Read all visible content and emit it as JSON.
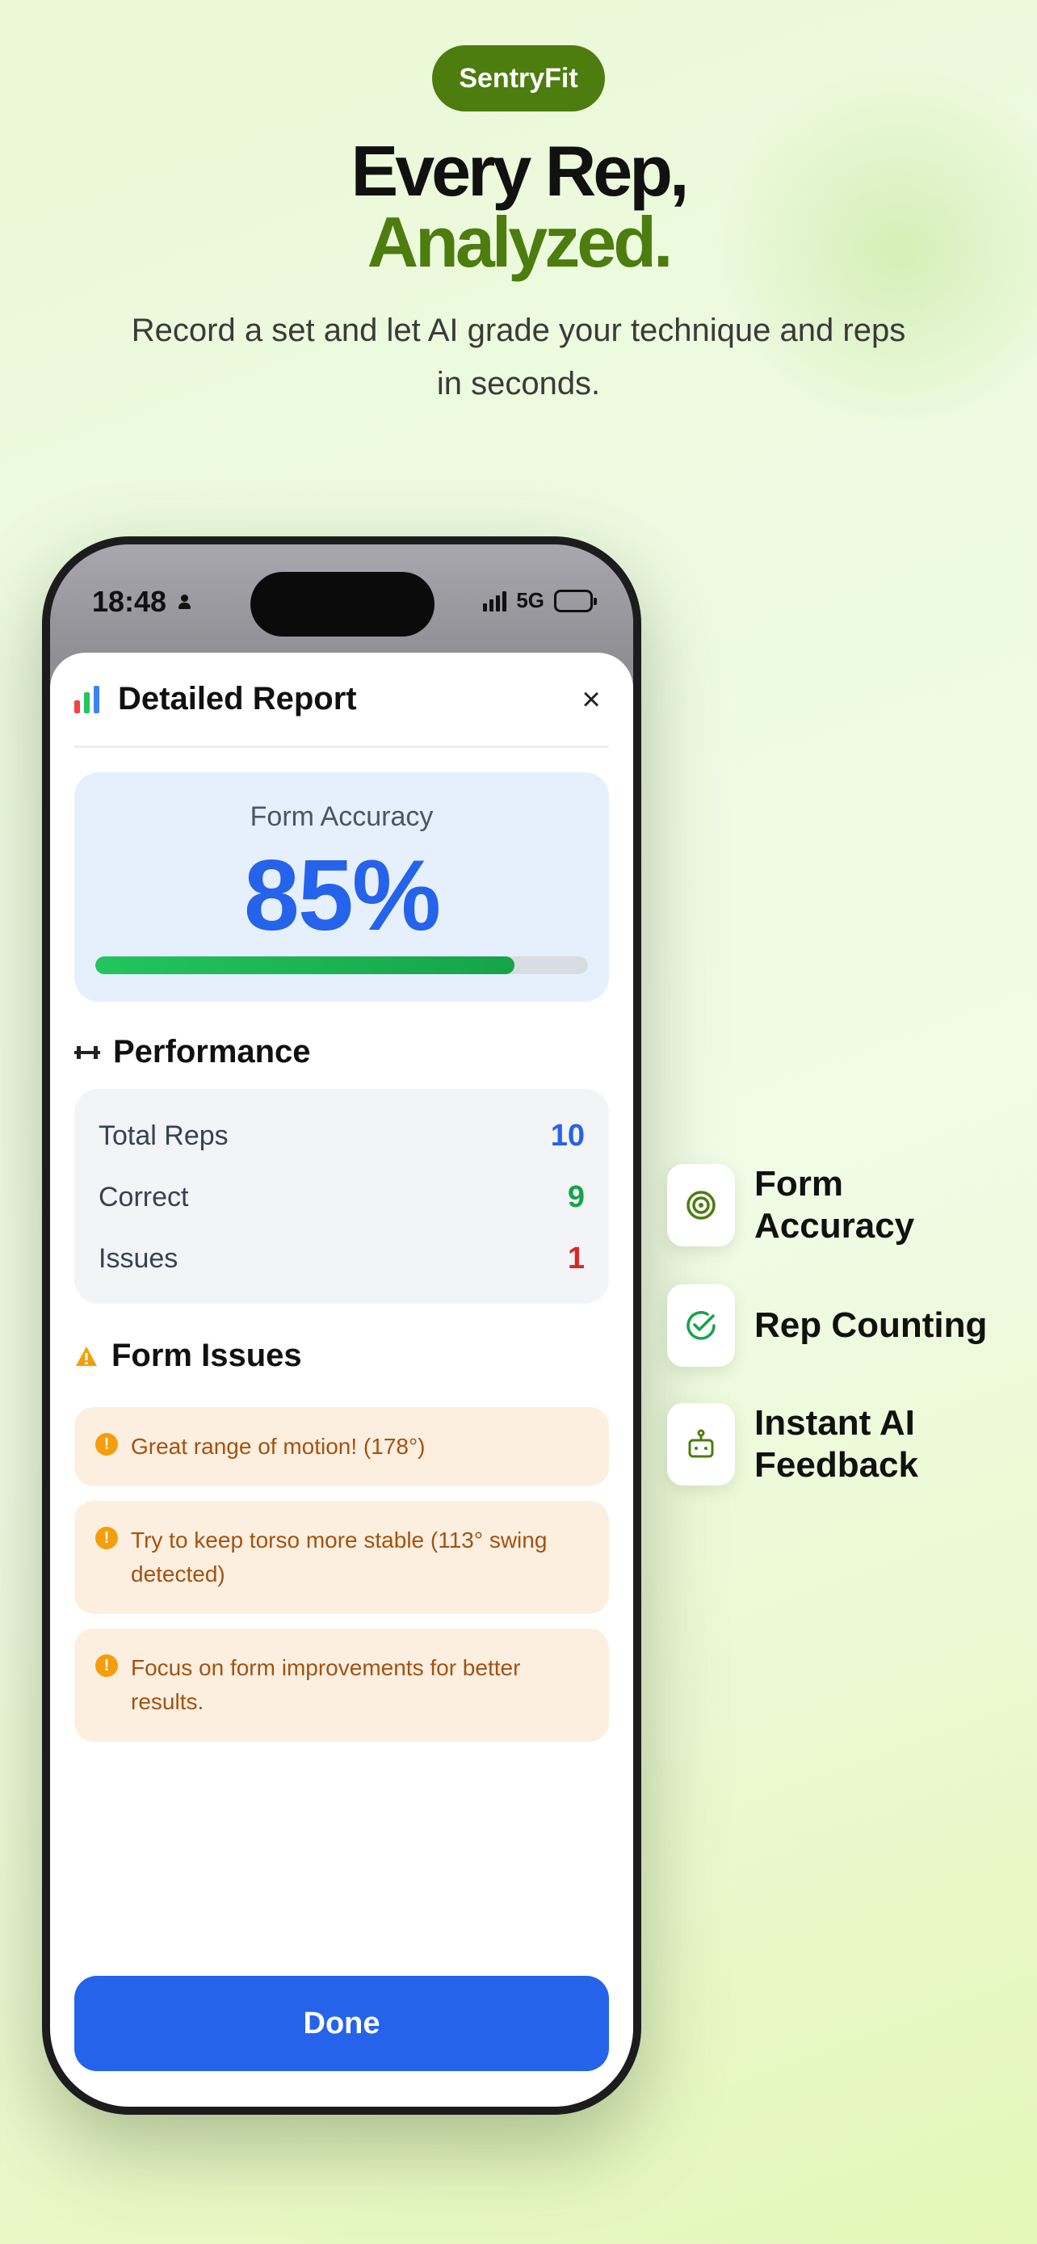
{
  "hero": {
    "brand": "SentryFit",
    "headline_line1": "Every Rep,",
    "headline_line2": "Analyzed.",
    "subtitle": "Record a set and let AI grade your technique and reps in seconds."
  },
  "status_bar": {
    "time": "18:48",
    "network": "5G"
  },
  "report": {
    "title": "Detailed Report",
    "close": "×",
    "accuracy_label": "Form Accuracy",
    "accuracy_value": "85%",
    "accuracy_fraction": 0.85,
    "performance_title": "Performance",
    "performance": [
      {
        "label": "Total Reps",
        "value": "10",
        "color": "#2563eb"
      },
      {
        "label": "Correct",
        "value": "9",
        "color": "#16a34a"
      },
      {
        "label": "Issues",
        "value": "1",
        "color": "#dc2626"
      }
    ],
    "issues_title": "Form Issues",
    "issues": [
      "Great range of motion! (178°)",
      "Try to keep torso more stable (113° swing detected)",
      "Focus on form improvements for better results."
    ],
    "done": "Done"
  },
  "features": [
    {
      "icon": "target-icon",
      "label": "Form Accuracy"
    },
    {
      "icon": "check-circle-icon",
      "label": "Rep Counting"
    },
    {
      "icon": "robot-icon",
      "label": "Instant AI Feedback"
    }
  ],
  "colors": {
    "brand_green": "#4d7c0f",
    "accent_blue": "#2563eb",
    "success_green": "#16a34a",
    "error_red": "#dc2626",
    "warning_orange": "#f59e0b"
  }
}
